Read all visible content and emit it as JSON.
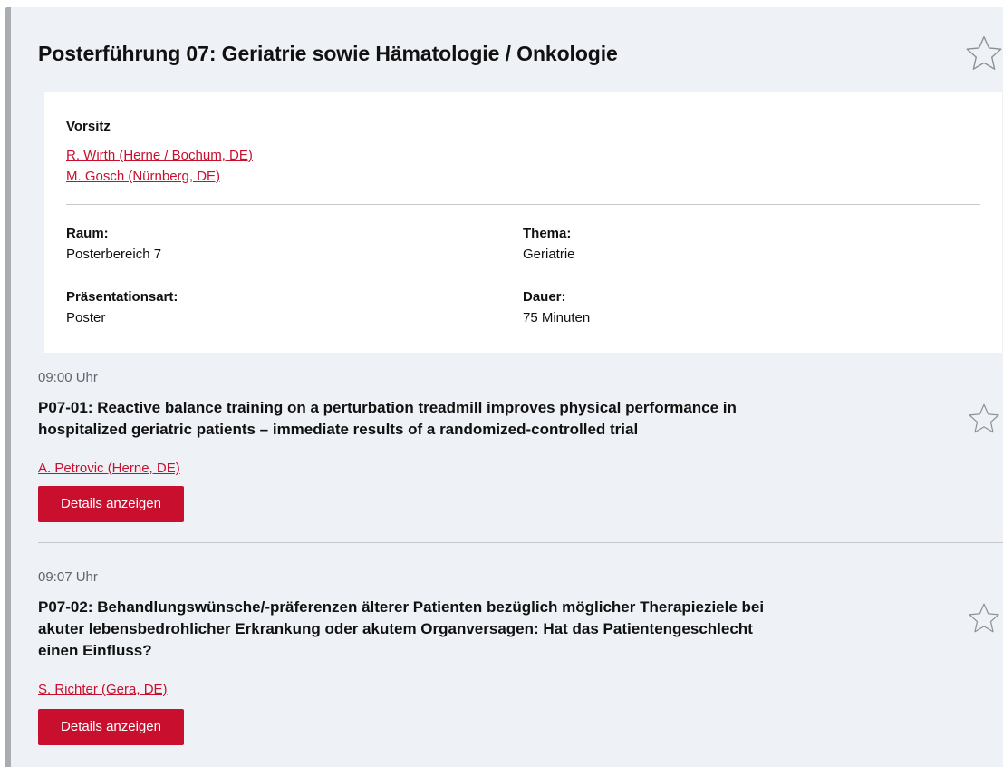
{
  "session": {
    "title": "Posterführung 07: Geriatrie sowie Hämatologie / Onkologie",
    "chair_label": "Vorsitz",
    "chairs": [
      "R. Wirth (Herne / Bochum, DE)",
      "M. Gosch (Nürnberg, DE)"
    ],
    "details": {
      "room_label": "Raum:",
      "room_value": "Posterbereich 7",
      "topic_label": "Thema:",
      "topic_value": "Geriatrie",
      "type_label": "Präsentationsart:",
      "type_value": "Poster",
      "duration_label": "Dauer:",
      "duration_value": "75 Minuten"
    },
    "favorite_icon": "star-outline-icon"
  },
  "presentations": [
    {
      "time": "09:00 Uhr",
      "title_line1": "P07-01: Reactive balance training on a perturbation treadmill improves physical performance in",
      "title_line2": "hospitalized geriatric patients – immediate results of a randomized-controlled trial",
      "author": "A. Petrovic (Herne, DE)",
      "button_label": "Details anzeigen"
    },
    {
      "time": "09:07 Uhr",
      "title_line1": "P07-02: Behandlungswünsche/-präferenzen älterer Patienten bezüglich möglicher Therapieziele bei",
      "title_line2": "akuter lebensbedrohlicher Erkrankung oder akutem Organversagen: Hat das Patientengeschlecht",
      "title_line3": "einen Einfluss?",
      "author": "S. Richter (Gera, DE)",
      "button_label": "Details anzeigen"
    }
  ],
  "colors": {
    "accent": "#c8102e",
    "panel_bg": "#eef1f5",
    "left_bar": "#a9acb1"
  }
}
